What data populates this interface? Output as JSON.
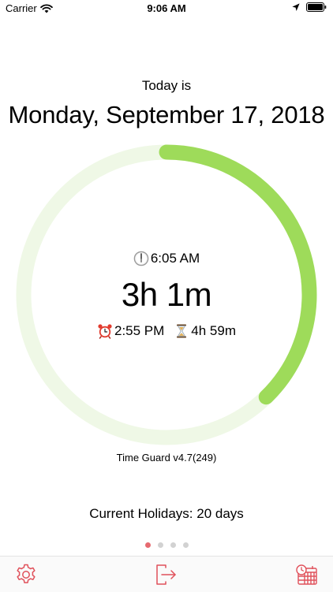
{
  "status_bar": {
    "carrier": "Carrier",
    "time": "9:06 AM"
  },
  "header": {
    "today_label": "Today is",
    "date": "Monday, September 17, 2018"
  },
  "timer": {
    "start_time": "6:05 AM",
    "elapsed": "3h 1m",
    "alarm_time": "2:55 PM",
    "remaining": "4h 59m",
    "progress_fraction": 0.377
  },
  "footer": {
    "version": "Time Guard v4.7(249)",
    "holidays": "Current Holidays: 20 days"
  },
  "pager": {
    "count": 4,
    "active_index": 0
  },
  "tab_bar": {
    "items": [
      "gear-icon",
      "exit-icon",
      "calendar-clock-icon"
    ]
  },
  "colors": {
    "accent_green": "#9edb5a",
    "track_green": "#eff8e6",
    "tab_red": "#e0505a",
    "dot_active": "#e66a70",
    "dot_inactive": "#d2d2d2"
  }
}
